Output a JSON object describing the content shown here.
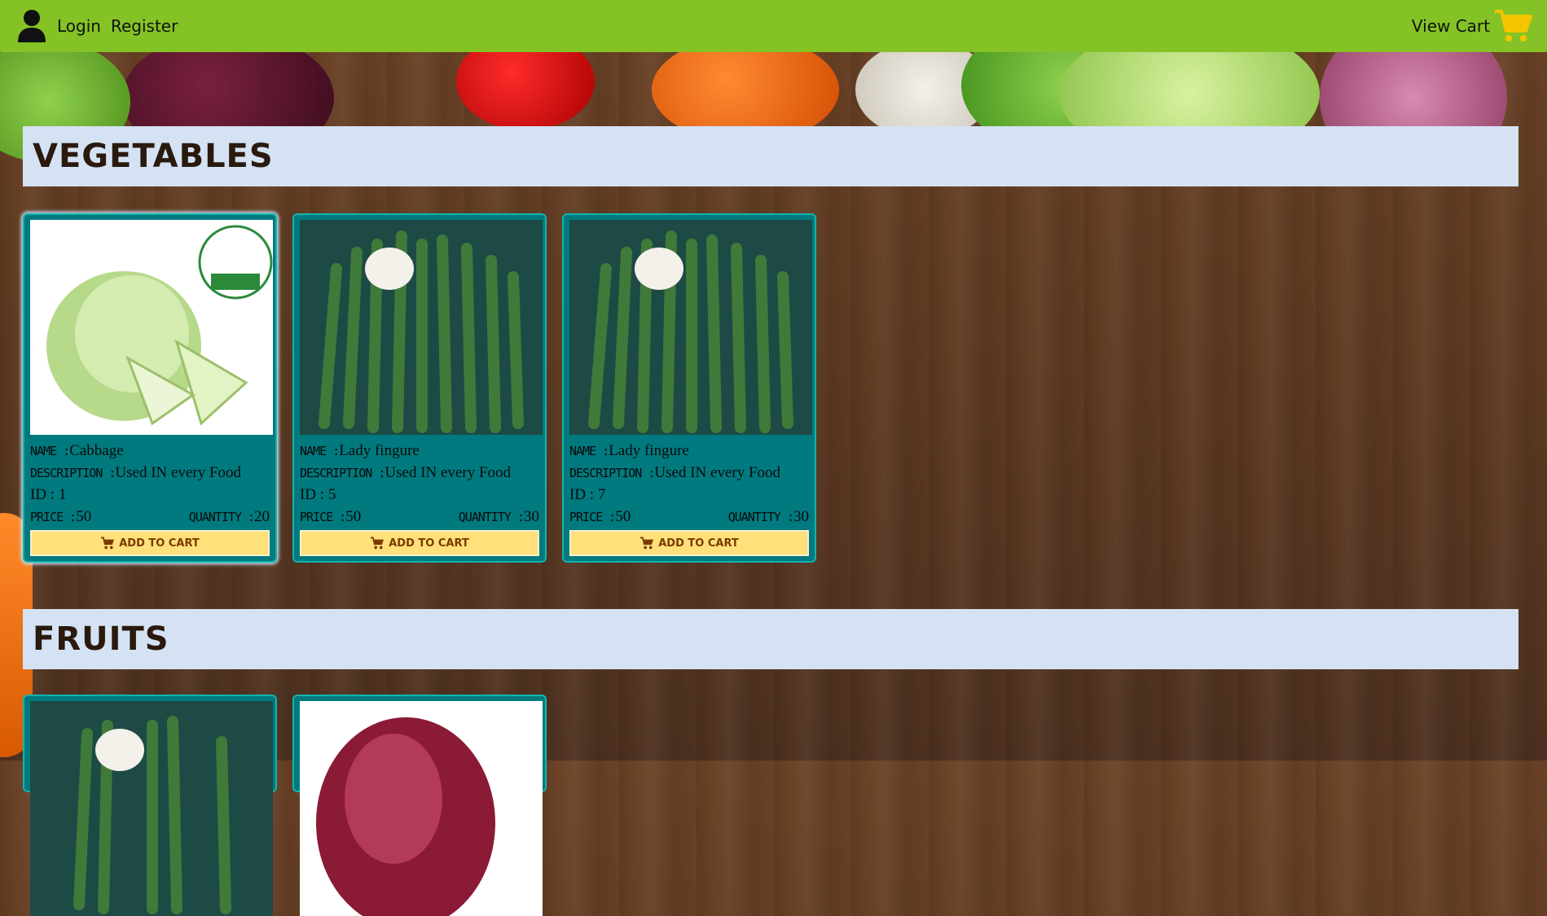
{
  "nav": {
    "login": "Login",
    "register": "Register",
    "view_cart": "View Cart"
  },
  "colors": {
    "topbar": "#84c225",
    "card": "#007a7f",
    "header_band": "#d4e2f4",
    "button": "#ffe07a",
    "cart_icon": "#f5c400"
  },
  "sections": [
    {
      "title": "VEGETABLES",
      "products": [
        {
          "name": "Cabbage",
          "description": "Used IN every Food",
          "id": "ID : 1",
          "price": "50",
          "quantity": "20",
          "image": "cabbage"
        },
        {
          "name": "Lady fingure",
          "description": "Used IN every Food",
          "id": "ID : 5",
          "price": "50",
          "quantity": "30",
          "image": "okra"
        },
        {
          "name": "Lady fingure",
          "description": "Used IN every Food",
          "id": "ID : 7",
          "price": "50",
          "quantity": "30",
          "image": "okra"
        }
      ]
    },
    {
      "title": "FRUITS",
      "products": [
        {
          "image": "okra"
        },
        {
          "image": "onion"
        }
      ]
    }
  ],
  "labels": {
    "name": "NAME :",
    "description": "DESCRIPTION :",
    "price": "PRICE :",
    "quantity": "QUANTITY :",
    "add_to_cart": "ADD TO CART"
  },
  "icons": {
    "user": "user-icon",
    "cart": "cart-icon"
  }
}
